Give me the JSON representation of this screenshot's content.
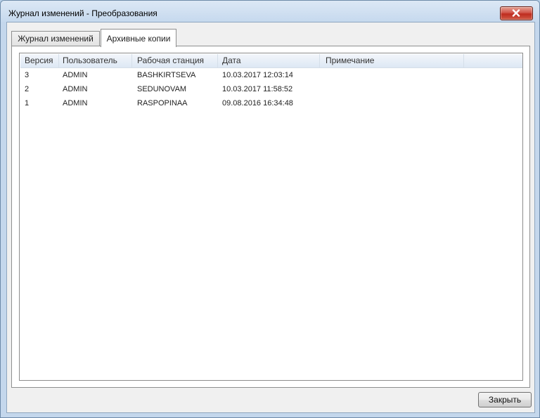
{
  "window": {
    "title": "Журнал изменений - Преобразования"
  },
  "tabs": [
    {
      "label": "Журнал изменений",
      "active": false
    },
    {
      "label": "Архивные копии",
      "active": true
    }
  ],
  "table": {
    "columns": [
      "Версия",
      "Пользователь",
      "Рабочая станция",
      "Дата",
      "Примечание"
    ],
    "rows": [
      {
        "version": "3",
        "user": "ADMIN",
        "workstation": "BASHKIRTSEVA",
        "date": "10.03.2017 12:03:14",
        "note": ""
      },
      {
        "version": "2",
        "user": "ADMIN",
        "workstation": "SEDUNOVAM",
        "date": "10.03.2017 11:58:52",
        "note": ""
      },
      {
        "version": "1",
        "user": "ADMIN",
        "workstation": "RASPOPINAA",
        "date": "09.08.2016 16:34:48",
        "note": ""
      }
    ]
  },
  "footer": {
    "close_label": "Закрыть"
  },
  "icons": {
    "window_close": "close-icon"
  }
}
